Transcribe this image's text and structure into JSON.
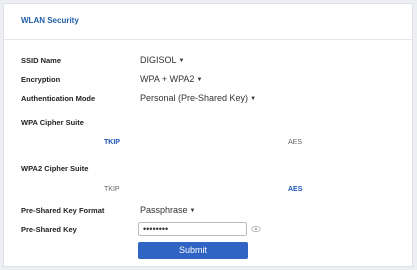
{
  "panel": {
    "title": "WLAN Security"
  },
  "form": {
    "ssid": {
      "label": "SSID Name",
      "value": "DIGISOL"
    },
    "encryption": {
      "label": "Encryption",
      "value": "WPA + WPA2"
    },
    "auth_mode": {
      "label": "Authentication Mode",
      "value": "Personal (Pre-Shared Key)"
    },
    "wpa_cipher": {
      "label": "WPA Cipher Suite",
      "options": [
        "TKIP",
        "AES"
      ],
      "selected": "TKIP"
    },
    "wpa2_cipher": {
      "label": "WPA2 Cipher Suite",
      "options": [
        "TKIP",
        "AES"
      ],
      "selected": "AES"
    },
    "psk_format": {
      "label": "Pre-Shared Key Format",
      "value": "Passphrase"
    },
    "psk": {
      "label": "Pre-Shared Key",
      "value": "••••••••",
      "show_icon": "eye-icon"
    },
    "submit_label": "Submit"
  },
  "colors": {
    "accent": "#2f64c4",
    "title": "#1f5fa8",
    "selected_option": "#1a55b5"
  }
}
